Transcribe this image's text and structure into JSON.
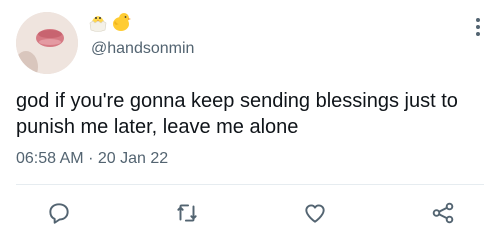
{
  "tweet": {
    "avatar_icon": "avatar-lips-icon",
    "emoji": [
      "hatching-chick-icon",
      "baby-chick-icon"
    ],
    "handle": "@handsonmin",
    "text": "god if you're gonna keep sending blessings just to punish me later, leave me alone",
    "time": "06:58 AM",
    "separator": "·",
    "date": "20 Jan 22",
    "more_icon": "more-vertical-icon"
  },
  "actions": {
    "reply": "reply-icon",
    "retweet": "retweet-icon",
    "like": "like-icon",
    "share": "share-icon"
  },
  "colors": {
    "text": "#0f1419",
    "muted": "#536471",
    "divider": "#e6ecf0",
    "icon": "#536471"
  }
}
